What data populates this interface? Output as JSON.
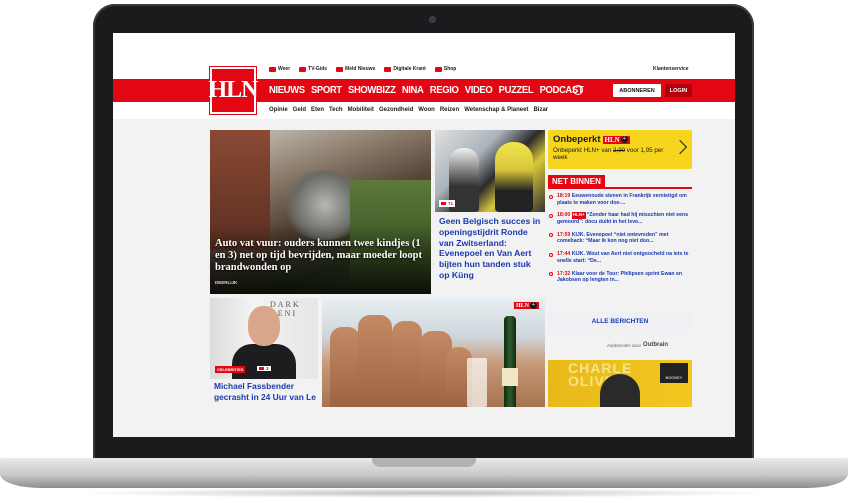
{
  "utility": {
    "items": [
      "Weer",
      "TV-Gids",
      "Meld Nieuws",
      "Digitale Krant",
      "Shop"
    ],
    "klantenservice": "Klantenservice"
  },
  "logo": "HLN",
  "nav": {
    "items": [
      "NIEUWS",
      "SPORT",
      "SHOWBIZZ",
      "NINA",
      "REGIO",
      "VIDEO",
      "PUZZEL",
      "PODCAST"
    ],
    "abonneren": "ABONNEREN",
    "login": "LOGIN"
  },
  "subnav": [
    "Opinie",
    "Geld",
    "Eten",
    "Tech",
    "Mobiliteit",
    "Gezondheid",
    "Woon",
    "Reizen",
    "Wetenschap & Planeet",
    "Bizar"
  ],
  "hero": {
    "title": "Auto vat vuur: ouders kunnen twee kindjes (1 en 3) net op tijd bevrijden, maar moeder loopt brandwonden op",
    "location": "DEERLIJK"
  },
  "article2": {
    "comments": "71",
    "title": "Geen Belgisch succes in openingstijdrit Ronde van Zwitserland: Evenepoel en Van Aert bijten hun tanden stuk op Küng"
  },
  "article3": {
    "image_text": "DARK\nOENI",
    "category": "CELEBRITIES",
    "comments": "3",
    "title": "Michael Fassbender gecrasht in 24 Uur van Le"
  },
  "article4": {
    "badge": "HLN"
  },
  "promo": {
    "title": "Onbeperkt",
    "badge": "HLN",
    "text_pre": "Onbeperkt HLN+ van ",
    "old_price": "2,90",
    "text_post": " voor 1,95 per week"
  },
  "net_binnen": {
    "label": "NET BINNEN",
    "items": [
      {
        "time": "18:19",
        "plus": "",
        "text": "Eeuwenoude stenen in Frankrijk vernietigd om plaats te maken voor doe-..."
      },
      {
        "time": "18:00",
        "plus": "HLN+",
        "text": "“Zonder haar had hij misschien niet eens gemoord”: docu duikt in het leve..."
      },
      {
        "time": "17:59",
        "plus": "",
        "text": "KIJK. Evenepoel “niet ontevreden” met comeback: “Maar ik kon nog niet doo..."
      },
      {
        "time": "17:44",
        "plus": "",
        "text": "KIJK. Wout van Aert niet ontgoocheld na iets te snelle start: “De..."
      },
      {
        "time": "17:32",
        "plus": "",
        "text": "Klaar voor de Tour: Philipsen sprint Ewan en Jakobsen op lengten in..."
      }
    ],
    "alle": "ALLE BERICHTEN"
  },
  "outbrain": {
    "label": "Aanbevolen door",
    "brand": "Outbrain"
  },
  "ad": {
    "text": "CHARLE\nOLIVEIR",
    "brand": "BOOKEY"
  }
}
